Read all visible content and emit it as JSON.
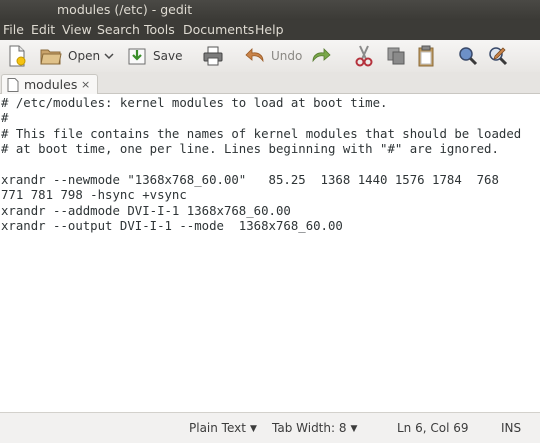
{
  "window": {
    "title": "modules (/etc) - gedit"
  },
  "menu": {
    "items": [
      "File",
      "Edit",
      "View",
      "Search",
      "Tools",
      "Documents",
      "Help"
    ]
  },
  "toolbar": {
    "open_label": "Open",
    "save_label": "Save",
    "undo_label": "Undo"
  },
  "tabs": [
    {
      "label": "modules",
      "close": "×"
    }
  ],
  "editor": {
    "lines": [
      "# /etc/modules: kernel modules to load at boot time.",
      "#",
      "# This file contains the names of kernel modules that should be loaded",
      "# at boot time, one per line. Lines beginning with \"#\" are ignored.",
      "",
      "xrandr --newmode \"1368x768_60.00\"   85.25  1368 1440 1576 1784  768",
      "771 781 798 -hsync +vsync",
      "xrandr --addmode DVI-I-1 1368x768_60.00",
      "xrandr --output DVI-I-1 --mode  1368x768_60.00"
    ]
  },
  "status": {
    "language": "Plain Text",
    "tab_width": "Tab Width: 8",
    "position": "Ln 6, Col 69",
    "mode": "INS"
  },
  "colors": {
    "titlebar_bg": "#3c3b37",
    "menubar_bg": "#3c3b37",
    "editor_bg": "#ffffff",
    "chrome_bg": "#f2f1f0"
  }
}
